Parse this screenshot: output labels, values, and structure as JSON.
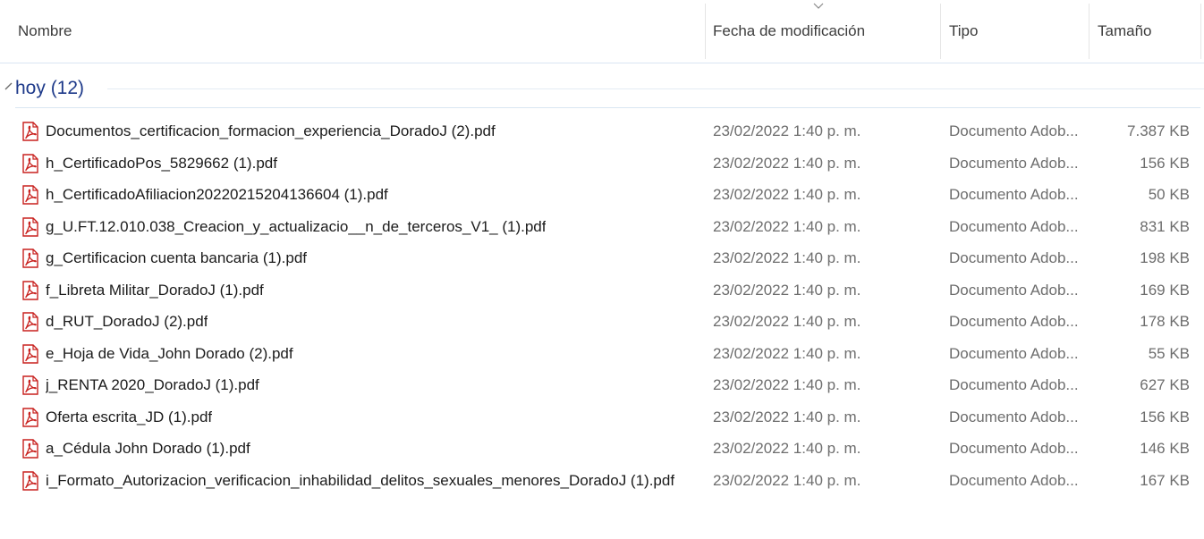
{
  "columns": {
    "name": "Nombre",
    "date": "Fecha de modificación",
    "type": "Tipo",
    "size": "Tamaño"
  },
  "group": {
    "label": "hoy (12)"
  },
  "files": [
    {
      "name": "Documentos_certificacion_formacion_experiencia_DoradoJ (2).pdf",
      "date": "23/02/2022 1:40 p. m.",
      "type": "Documento Adob...",
      "size": "7.387 KB"
    },
    {
      "name": "h_CertificadoPos_5829662 (1).pdf",
      "date": "23/02/2022 1:40 p. m.",
      "type": "Documento Adob...",
      "size": "156 KB"
    },
    {
      "name": "h_CertificadoAfiliacion20220215204136604 (1).pdf",
      "date": "23/02/2022 1:40 p. m.",
      "type": "Documento Adob...",
      "size": "50 KB"
    },
    {
      "name": "g_U.FT.12.010.038_Creacion_y_actualizacio__n_de_terceros_V1_ (1).pdf",
      "date": "23/02/2022 1:40 p. m.",
      "type": "Documento Adob...",
      "size": "831 KB"
    },
    {
      "name": "g_Certificacion cuenta bancaria (1).pdf",
      "date": "23/02/2022 1:40 p. m.",
      "type": "Documento Adob...",
      "size": "198 KB"
    },
    {
      "name": "f_Libreta Militar_DoradoJ (1).pdf",
      "date": "23/02/2022 1:40 p. m.",
      "type": "Documento Adob...",
      "size": "169 KB"
    },
    {
      "name": "d_RUT_DoradoJ (2).pdf",
      "date": "23/02/2022 1:40 p. m.",
      "type": "Documento Adob...",
      "size": "178 KB"
    },
    {
      "name": "e_Hoja de Vida_John Dorado (2).pdf",
      "date": "23/02/2022 1:40 p. m.",
      "type": "Documento Adob...",
      "size": "55 KB"
    },
    {
      "name": "j_RENTA 2020_DoradoJ (1).pdf",
      "date": "23/02/2022 1:40 p. m.",
      "type": "Documento Adob...",
      "size": "627 KB"
    },
    {
      "name": "Oferta escrita_JD (1).pdf",
      "date": "23/02/2022 1:40 p. m.",
      "type": "Documento Adob...",
      "size": "156 KB"
    },
    {
      "name": "a_Cédula John Dorado (1).pdf",
      "date": "23/02/2022 1:40 p. m.",
      "type": "Documento Adob...",
      "size": "146 KB"
    },
    {
      "name": "i_Formato_Autorizacion_verificacion_inhabilidad_delitos_sexuales_menores_DoradoJ (1).pdf",
      "date": "23/02/2022 1:40 p. m.",
      "type": "Documento Adob...",
      "size": "167 KB"
    }
  ],
  "icons": {
    "file": "pdf-file-icon",
    "sort": "chevron-down-icon",
    "group": "collapse-chevron-icon"
  },
  "colors": {
    "pdf_red": "#c8211e",
    "group_text": "#1e3a8a",
    "separator": "#d9e6f2"
  }
}
